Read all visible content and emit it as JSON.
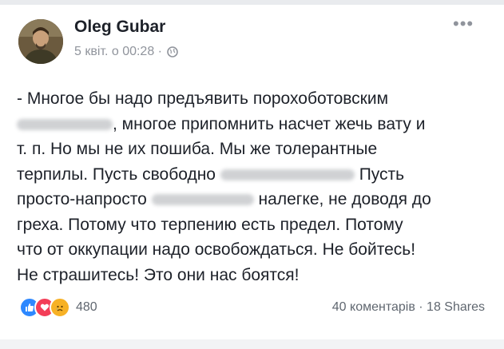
{
  "post": {
    "author": "Oleg Gubar",
    "timestamp": "5 квіт. о 00:28 ·",
    "privacy_icon": "globe-icon",
    "menu_icon": "ellipsis-icon",
    "lines": {
      "l1": "- Многое бы надо предъявить порохоботовским",
      "l2b": ", многое припомнить насчет жечь вату и",
      "l3": "т. п. Но мы не их пошиба. Мы же толерантные",
      "l4a": "терпилы. Пусть свободно",
      "l4c": "Пусть",
      "l5a": "просто-напросто",
      "l5c": "налегке, не доводя до",
      "l6": "греха. Потому что терпению есть предел. Потому",
      "l7": "что от оккупации надо освобождаться. Не бойтесь!",
      "l8": "Не страшитесь! Это они нас боятся!"
    }
  },
  "footer": {
    "reactions_count": "480",
    "reaction_icons": [
      "like-icon",
      "love-icon",
      "sad-icon"
    ],
    "comments_shares": "40 коментарів · 18 Shares"
  },
  "colors": {
    "like": "#2d88ff",
    "love": "#f33e58",
    "sad": "#f7b125",
    "meta_text": "#90949c"
  }
}
